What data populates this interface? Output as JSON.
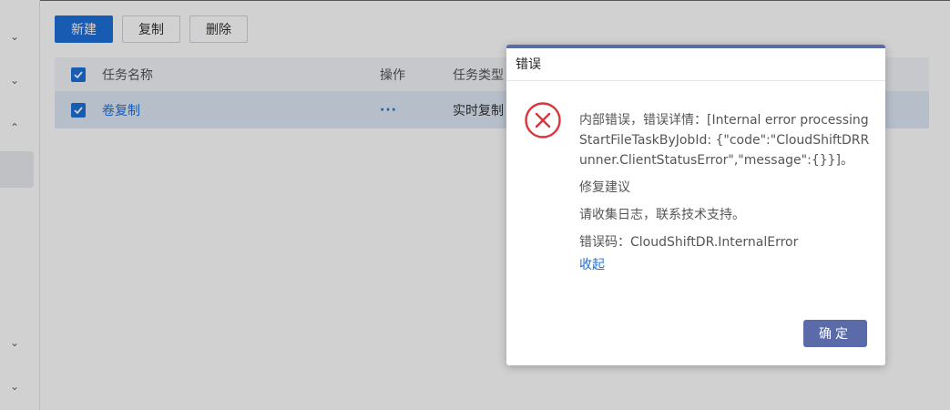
{
  "sidebar": {
    "icons": [
      "chevron-down-icon",
      "chevron-down-icon",
      "chevron-up-icon",
      "chevron-down-icon",
      "chevron-down-icon"
    ]
  },
  "toolbar": {
    "new_label": "新建",
    "copy_label": "复制",
    "delete_label": "删除"
  },
  "table": {
    "columns": [
      "任务名称",
      "操作",
      "任务类型"
    ],
    "rows": [
      {
        "name": "卷复制",
        "action": "···",
        "type": "实时复制"
      }
    ]
  },
  "dialog": {
    "title": "错误",
    "message": "内部错误，错误详情：[Internal error processing StartFileTaskByJobId: {\"code\":\"CloudShiftDRRunner.ClientStatusError\",\"message\":{}}]。",
    "suggestion_title": "修复建议",
    "suggestion": "请收集日志，联系技术支持。",
    "error_code": "错误码：CloudShiftDR.InternalError",
    "collapse_label": "收起",
    "ok_label": "确定"
  },
  "colors": {
    "primary": "#1e6fd9",
    "dialog_accent": "#5b6aa8",
    "error_red": "#d9363e"
  }
}
